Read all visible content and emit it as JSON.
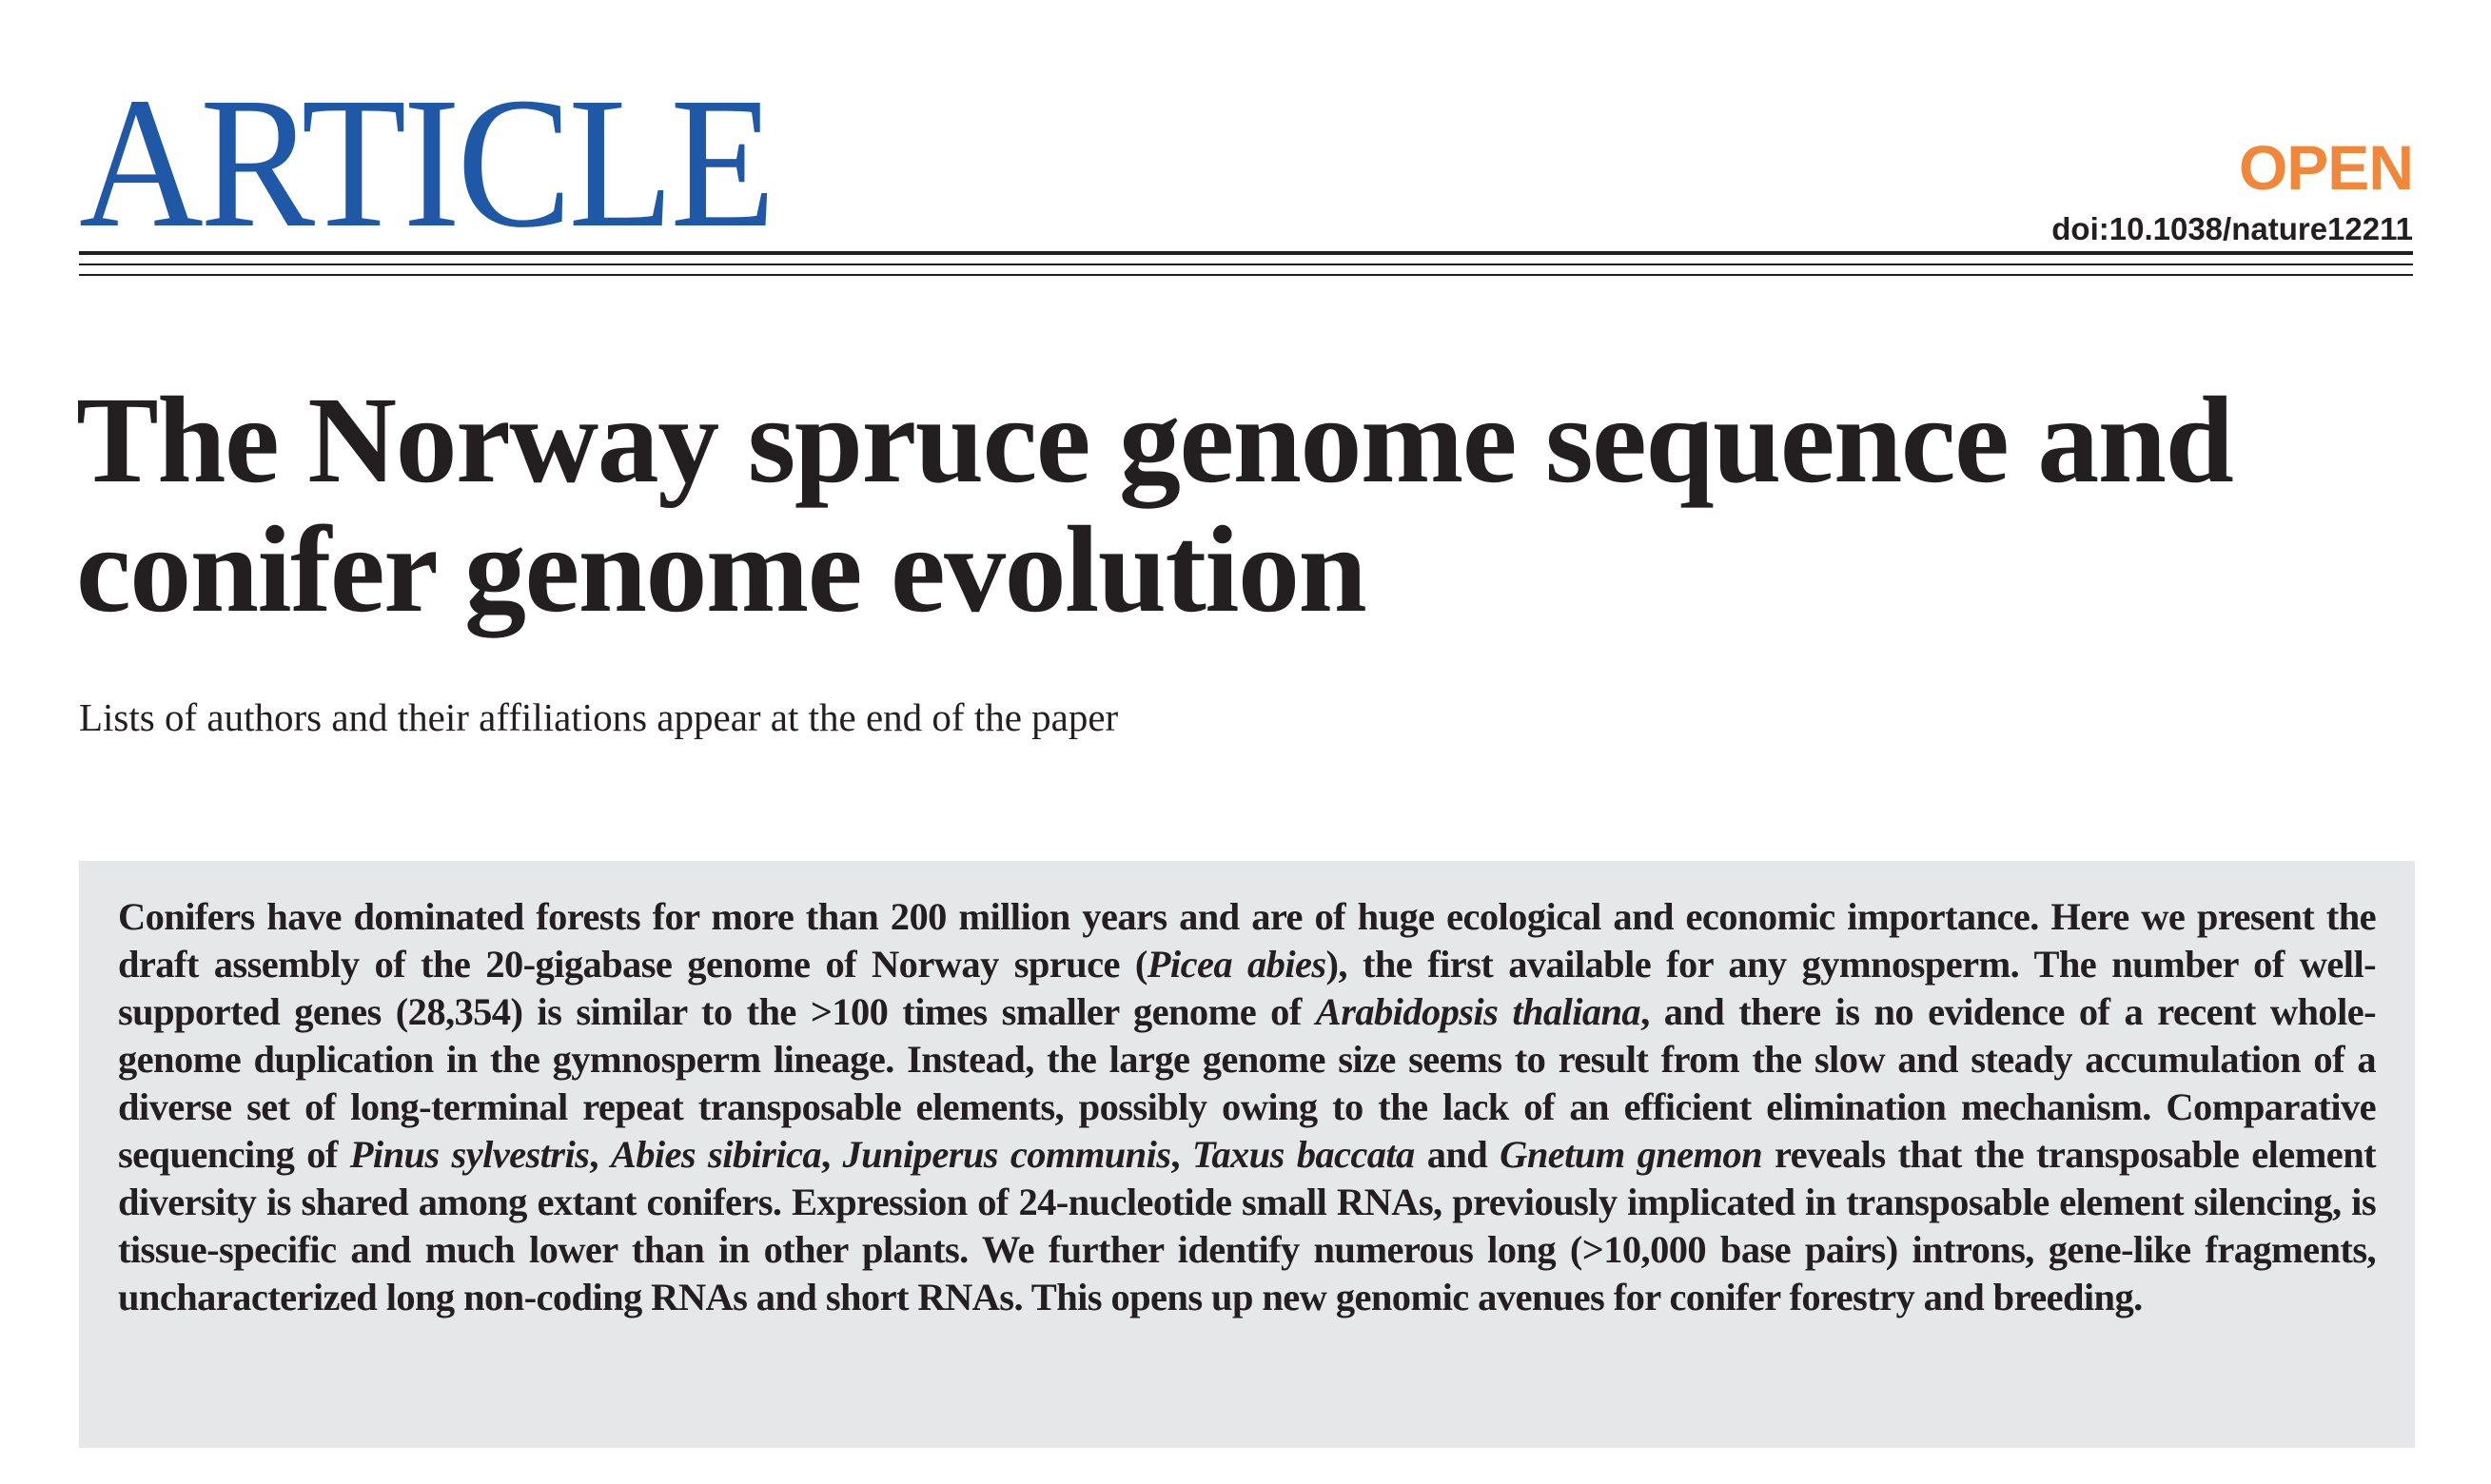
{
  "header": {
    "section_label": "ARTICLE",
    "access_badge": "OPEN",
    "doi": "doi:10.1038/nature12211"
  },
  "article": {
    "title": "The Norway spruce genome sequence and conifer genome evolution",
    "authors_note": "Lists of authors and their affiliations appear at the end of the paper"
  },
  "abstract": {
    "segments": [
      {
        "text": "Conifers have dominated forests for more than 200 million years and are of huge ecological and economic importance. Here we present the draft assembly of the 20-gigabase genome of Norway spruce (",
        "italic": false
      },
      {
        "text": "Picea abies",
        "italic": true
      },
      {
        "text": "), the first available for any gymnosperm. The number of well-supported genes (28,354) is similar to the >100 times smaller genome of ",
        "italic": false
      },
      {
        "text": "Arabidopsis thaliana",
        "italic": true
      },
      {
        "text": ", and there is no evidence of a recent whole-genome duplication in the gymnosperm lineage. Instead, the large genome size seems to result from the slow and steady accumulation of a diverse set of long-terminal repeat transposable elements, possibly owing to the lack of an efficient elimination mechanism. Comparative sequencing of ",
        "italic": false
      },
      {
        "text": "Pinus sylvestris",
        "italic": true
      },
      {
        "text": ", ",
        "italic": false
      },
      {
        "text": "Abies sibirica",
        "italic": true
      },
      {
        "text": ", ",
        "italic": false
      },
      {
        "text": "Juniperus communis",
        "italic": true
      },
      {
        "text": ", ",
        "italic": false
      },
      {
        "text": "Taxus baccata",
        "italic": true
      },
      {
        "text": " and ",
        "italic": false
      },
      {
        "text": "Gnetum gnemon",
        "italic": true
      },
      {
        "text": " reveals that the transposable element diversity is shared among extant conifers. Expression of 24-nucleotide small RNAs, previously implicated in transposable element silencing, is tissue-specific and much lower than in other plants. We further identify numerous long (>10,000 base pairs) introns, gene-like fragments, uncharacterized long non-coding RNAs and short RNAs. This opens up new genomic avenues for conifer forestry and breeding.",
        "italic": false
      }
    ]
  },
  "colors": {
    "masthead_blue": "#1f58a6",
    "open_orange": "#f0873a",
    "text_dark": "#231f20",
    "abstract_bg": "#e6e7e8"
  }
}
